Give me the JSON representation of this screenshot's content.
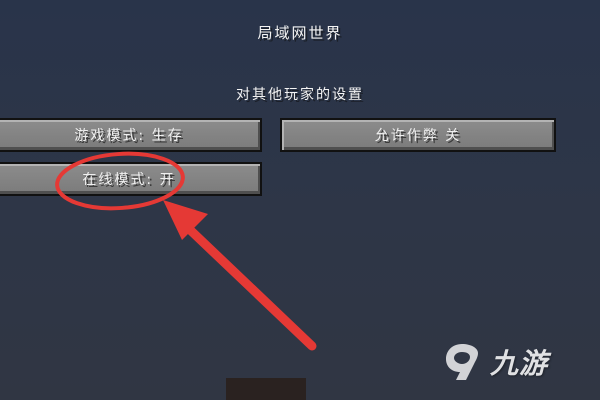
{
  "screen": {
    "title": "局域网世界",
    "subtitle": "对其他玩家的设置"
  },
  "buttons": {
    "game_mode": "游戏模式: 生存",
    "allow_cheats": "允许作弊 关",
    "online_mode": "在线模式: 开"
  },
  "annotation": {
    "color": "#e53935",
    "shapes": [
      "ellipse-highlight",
      "arrow"
    ]
  },
  "watermark": {
    "text": "九游",
    "icon": "jiuyou-logo-icon"
  }
}
